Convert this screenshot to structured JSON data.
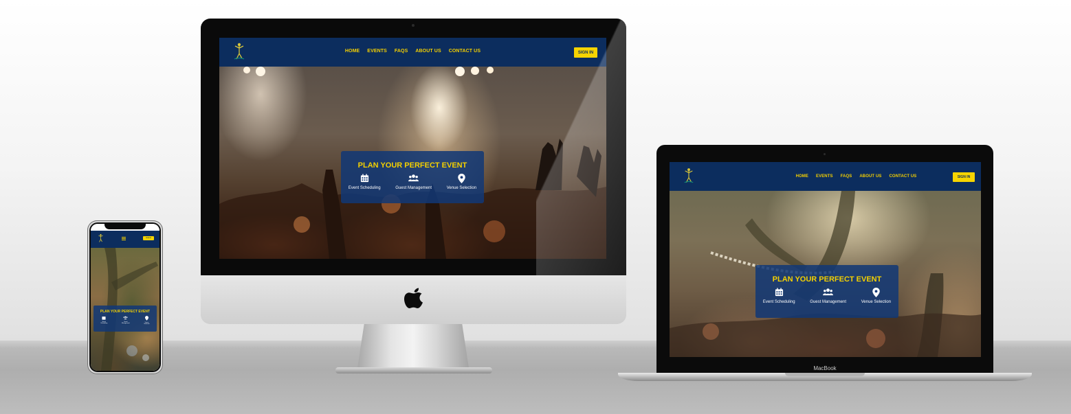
{
  "site": {
    "nav": [
      "HOME",
      "EVENTS",
      "FAQS",
      "ABOUT US",
      "CONTACT US"
    ],
    "signin": "SIGN IN",
    "hero_title": "PLAN YOUR PERFECT EVENT",
    "features": [
      {
        "label": "Event Scheduling",
        "icon": "calendar-icon"
      },
      {
        "label": "Guest Management",
        "icon": "users-icon"
      },
      {
        "label": "Venue Selection",
        "icon": "location-pin-icon"
      }
    ],
    "mobile_features": [
      {
        "line1": "Event",
        "line2": "Scheduling"
      },
      {
        "line1": "Guest",
        "line2": "Management"
      },
      {
        "line1": "Venue",
        "line2": "Selection"
      }
    ]
  },
  "devices": {
    "laptop_label": "MacBook",
    "desktop_logo": "apple-logo-icon",
    "phone_menu_icon": "hamburger-icon"
  },
  "colors": {
    "nav_bg": "#0c2d5e",
    "accent_yellow": "#f6d400",
    "hero_box": "#123876"
  }
}
